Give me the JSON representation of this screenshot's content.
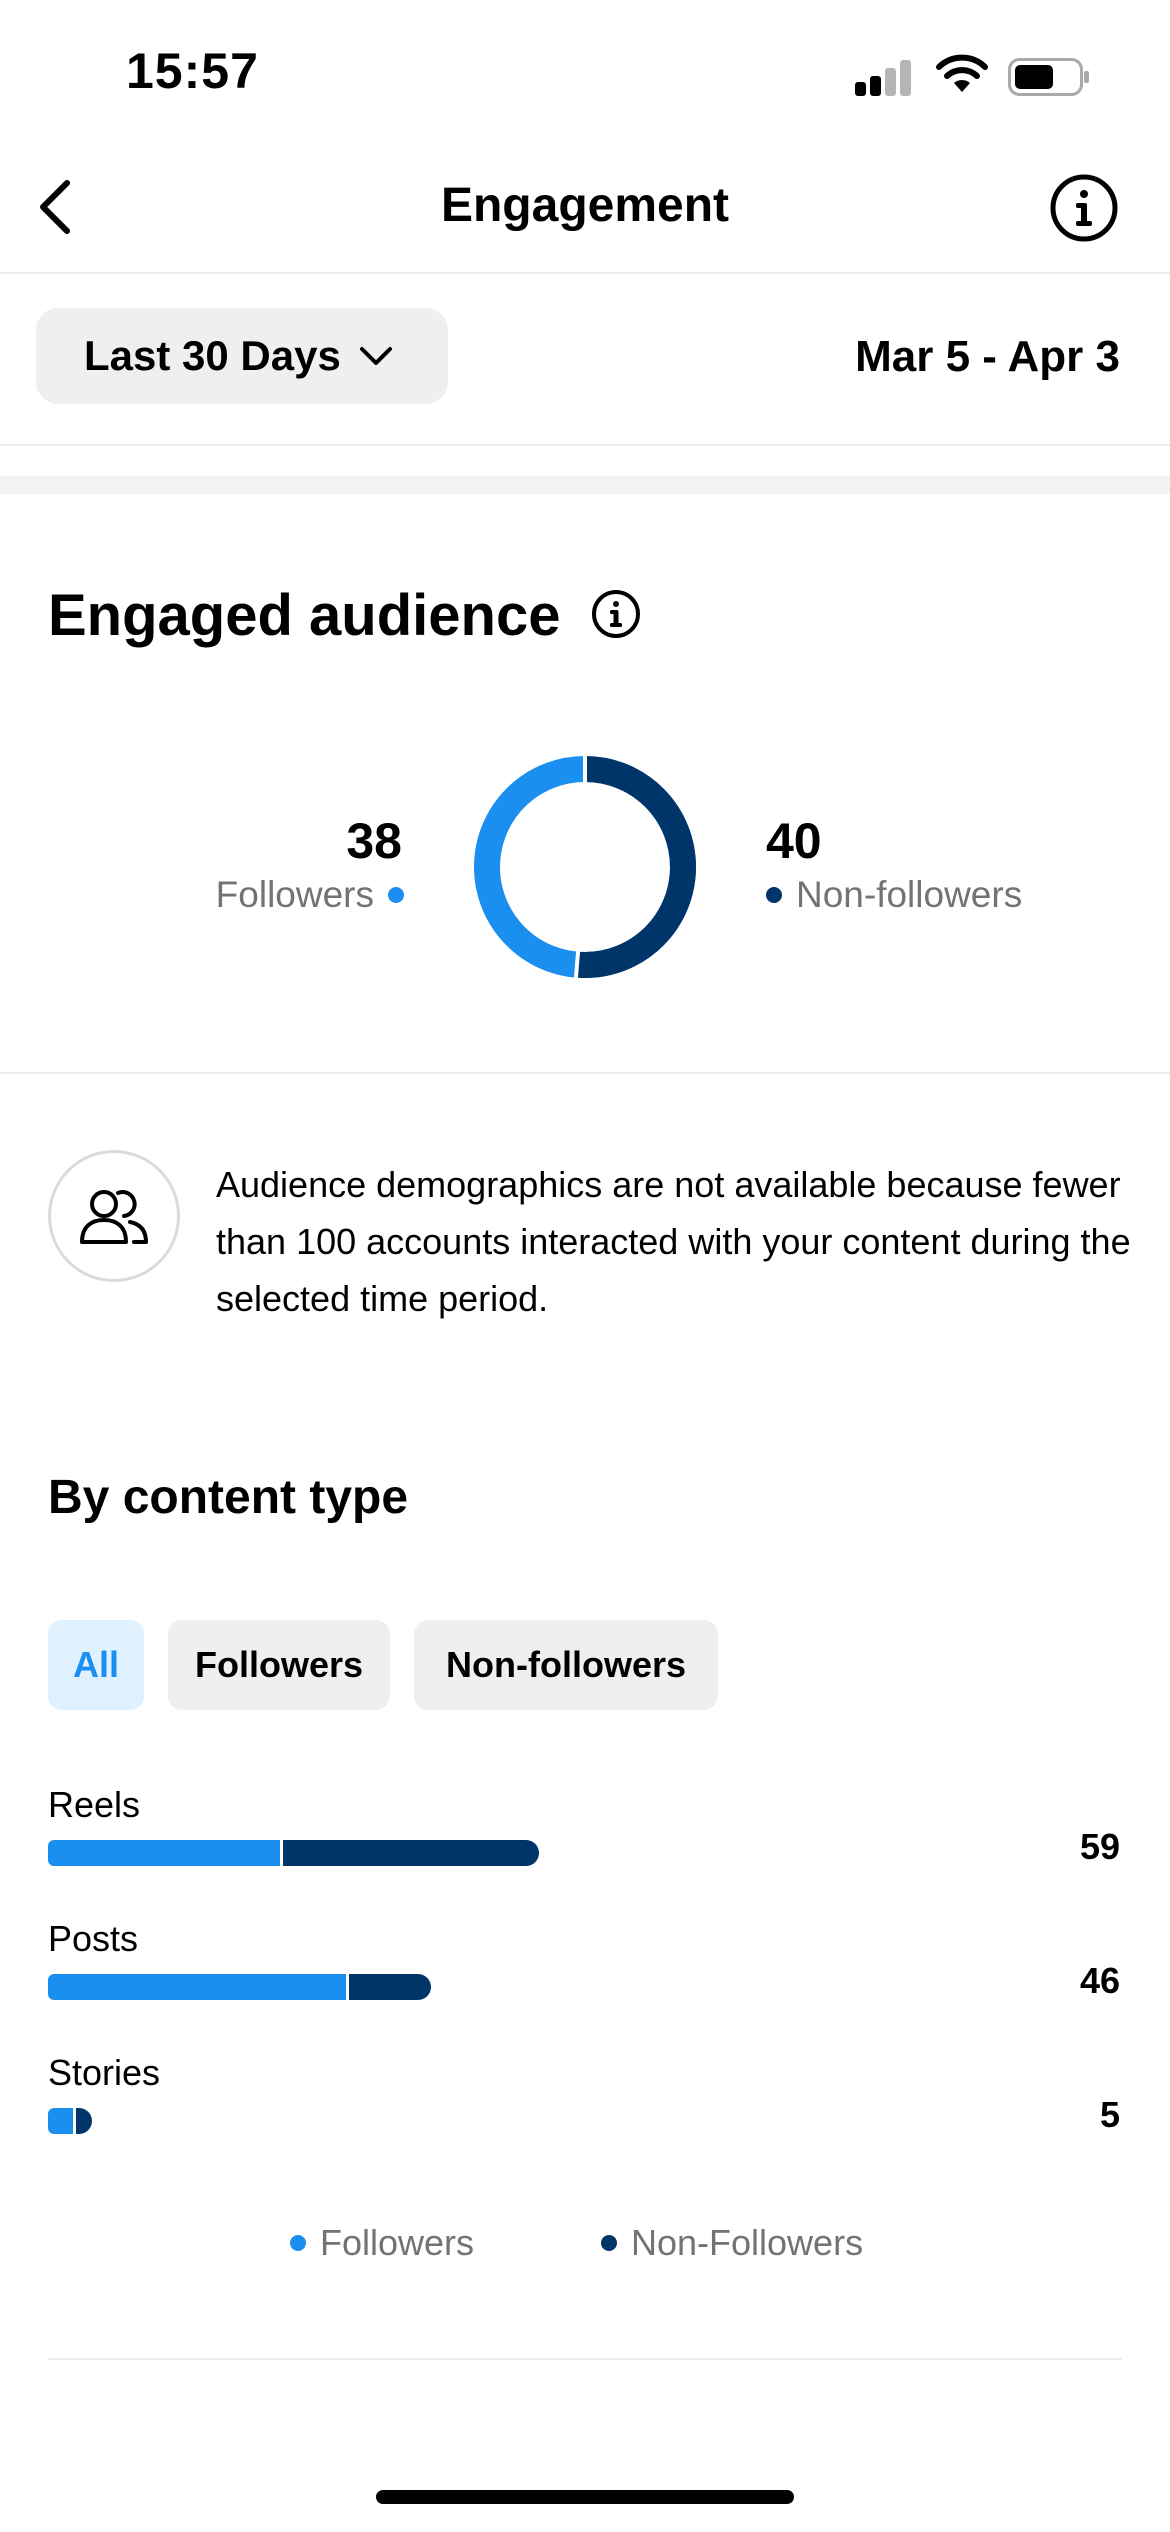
{
  "status_bar": {
    "time": "15:57"
  },
  "header": {
    "title": "Engagement"
  },
  "filter": {
    "range_label": "Last 30 Days",
    "date_range": "Mar 5 - Apr 3"
  },
  "engaged_audience": {
    "title": "Engaged audience",
    "followers": {
      "count": "38",
      "label": "Followers"
    },
    "non_followers": {
      "count": "40",
      "label": "Non-followers"
    },
    "followers_fraction": 0.487
  },
  "demographics_notice": {
    "text": "Audience demographics are not available because fewer than 100 accounts interacted with your content during the selected time period."
  },
  "content_type": {
    "title": "By content type",
    "chips": [
      "All",
      "Followers",
      "Non-followers"
    ],
    "active_chip": "All",
    "max_value": 59,
    "rows": [
      {
        "label": "Reels",
        "value": "59",
        "followers": 28,
        "non_followers": 31
      },
      {
        "label": "Posts",
        "value": "46",
        "followers": 36,
        "non_followers": 10
      },
      {
        "label": "Stories",
        "value": "5",
        "followers": 3,
        "non_followers": 2
      }
    ],
    "legend": {
      "followers": "Followers",
      "non_followers": "Non-Followers"
    }
  },
  "colors": {
    "followers": "#1b8ff0",
    "non_followers": "#003569",
    "chip_active_bg": "#dff1ff",
    "chip_bg": "#efefef"
  }
}
